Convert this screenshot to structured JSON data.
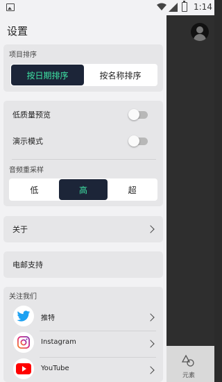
{
  "status_bar": {
    "time": "1:14"
  },
  "drawer": {
    "title": "设置",
    "sort_section": {
      "label": "项目排序",
      "options": [
        "按日期排序",
        "按名称排序"
      ],
      "selected": "按日期排序"
    },
    "display_section": {
      "low_quality_preview": {
        "label": "低质量预览",
        "enabled": false
      },
      "demo_mode": {
        "label": "演示模式",
        "enabled": false
      },
      "resample": {
        "label": "音频重采样",
        "options": [
          "低",
          "高",
          "超"
        ],
        "selected": "高"
      }
    },
    "about": {
      "label": "关于"
    },
    "email_support": {
      "label": "电邮支持"
    },
    "follow_us": {
      "label": "关注我们",
      "items": [
        {
          "label": "推特",
          "icon": "twitter-icon"
        },
        {
          "label": "Instagram",
          "icon": "instagram-icon"
        },
        {
          "label": "YouTube",
          "icon": "youtube-icon"
        }
      ]
    }
  },
  "background_app": {
    "bottom_tab_label": "元素"
  },
  "colors": {
    "accent": "#3EE3A4",
    "selected_bg": "#1C2538",
    "twitter": "#1DA1F2",
    "youtube": "#FF0000"
  }
}
